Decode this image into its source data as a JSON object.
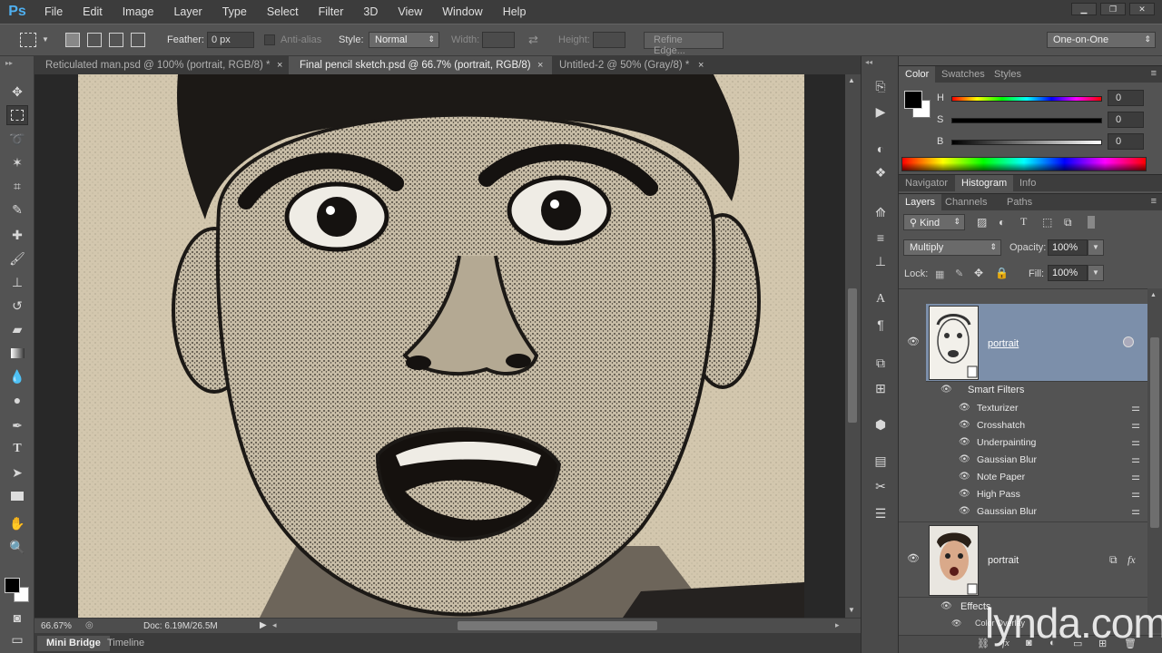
{
  "app": {
    "logo": "Ps"
  },
  "menu": [
    "File",
    "Edit",
    "Image",
    "Layer",
    "Type",
    "Select",
    "Filter",
    "3D",
    "View",
    "Window",
    "Help"
  ],
  "options": {
    "feather_label": "Feather:",
    "feather_value": "0 px",
    "antialias_label": "Anti-alias",
    "style_label": "Style:",
    "style_value": "Normal",
    "width_label": "Width:",
    "height_label": "Height:",
    "refine_edge": "Refine Edge...",
    "workspace": "One-on-One"
  },
  "tabs": [
    {
      "label": "Reticulated man.psd @ 100% (portrait, RGB/8) *",
      "close": "×"
    },
    {
      "label": "Final pencil sketch.psd @ 66.7% (portrait, RGB/8)",
      "close": "×"
    },
    {
      "label": "Untitled-2 @ 50% (Gray/8) *",
      "close": "×"
    }
  ],
  "status": {
    "zoom": "66.67%",
    "doc": "Doc: 6.19M/26.5M"
  },
  "bottom_tabs": [
    "Mini Bridge",
    "Timeline"
  ],
  "color_panel": {
    "tabs": [
      "Color",
      "Swatches",
      "Styles"
    ],
    "sliders": [
      {
        "letter": "H",
        "value": "0"
      },
      {
        "letter": "S",
        "value": "0"
      },
      {
        "letter": "B",
        "value": "0"
      }
    ]
  },
  "nav_panel": {
    "tabs": [
      "Navigator",
      "Histogram",
      "Info"
    ]
  },
  "layers_panel": {
    "tabs": [
      "Layers",
      "Channels",
      "Paths"
    ],
    "kind": "Kind",
    "blend_mode": "Multiply",
    "opacity_label": "Opacity:",
    "opacity_value": "100%",
    "lock_label": "Lock:",
    "fill_label": "Fill:",
    "fill_value": "100%",
    "layer1_name": "portrait",
    "smart_filters_label": "Smart Filters",
    "filters": [
      "Texturizer",
      "Crosshatch",
      "Underpainting",
      "Gaussian Blur",
      "Note Paper",
      "High Pass",
      "Gaussian Blur"
    ],
    "layer2_name": "portrait",
    "effects_label": "Effects",
    "effect_item": "Color Overlay"
  },
  "watermark": "lynda.com",
  "colors": {
    "accent_selected": "#7c8faa",
    "ps_blue": "#4fb0f0"
  }
}
